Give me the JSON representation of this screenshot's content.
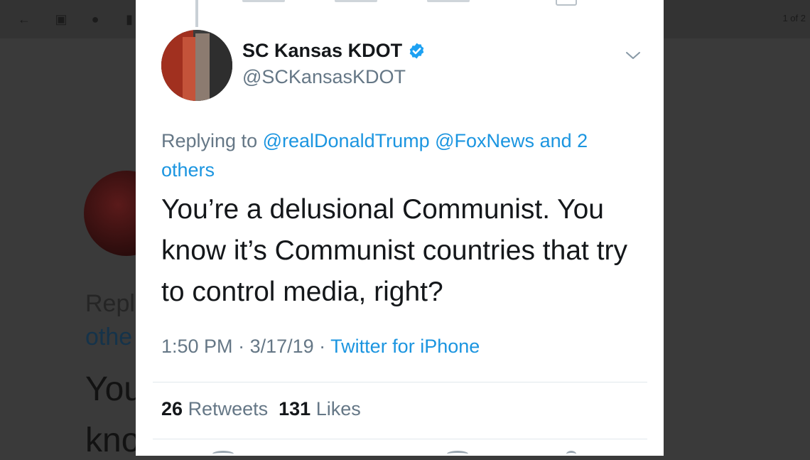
{
  "background": {
    "pager": "1 of 2",
    "reply_fragment": "Repl",
    "others_fragment": "othe",
    "text_fragment_1": "You",
    "text_fragment_2": "kno",
    "toolbar_icons": [
      "back-arrow-icon",
      "archive-icon",
      "alert-icon",
      "trash-icon"
    ]
  },
  "tweet": {
    "display_name": "SC Kansas KDOT",
    "handle": "@SCKansasKDOT",
    "verified": true,
    "replying_prefix": "Replying to",
    "reply_mention_1": "@realDonaldTrump",
    "reply_mention_2": "@FoxNews",
    "reply_and_others": "and 2 others",
    "text": "You’re a delusional Communist. You know it’s Communist countries that try to control media, right?",
    "time": "1:50 PM",
    "date": "3/17/19",
    "source": "Twitter for iPhone",
    "retweets_count": "26",
    "retweets_label": "Retweets",
    "likes_count": "131",
    "likes_label": "Likes"
  },
  "colors": {
    "link": "#1b95e0",
    "secondary_text": "#657786",
    "primary_text": "#14171a"
  }
}
